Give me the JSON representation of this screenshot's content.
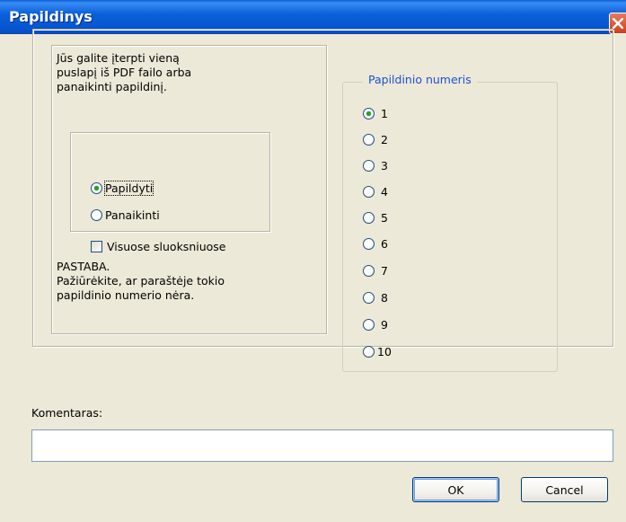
{
  "window": {
    "title": "Papildinys"
  },
  "info": {
    "lines": [
      "Jūs galite įterpti vieną",
      "puslapį iš PDF failo arba",
      "panaikinti papildinį."
    ]
  },
  "mode": {
    "options": [
      {
        "label": "Papildyti",
        "checked": true
      },
      {
        "label": "Panaikinti",
        "checked": false
      }
    ],
    "checkbox": {
      "label": "Visuose sluoksniuose",
      "checked": false
    }
  },
  "note": {
    "lines": [
      "PASTABA.",
      "Pažiūrėkite, ar paraštėje tokio",
      "papildinio numerio nėra."
    ]
  },
  "numbers": {
    "legend": "Papildinio numeris",
    "options": [
      "1",
      "2",
      "3",
      "4",
      "5",
      "6",
      "7",
      "8",
      "9",
      "10"
    ],
    "selected": "1"
  },
  "comment": {
    "label": "Komentaras:",
    "value": ""
  },
  "buttons": {
    "ok": "OK",
    "cancel": "Cancel"
  },
  "colors": {
    "titlebar": "#0554cf",
    "dialog_bg": "#ece9d8",
    "legend": "#1d50d2",
    "radio_dot": "#21a121"
  }
}
